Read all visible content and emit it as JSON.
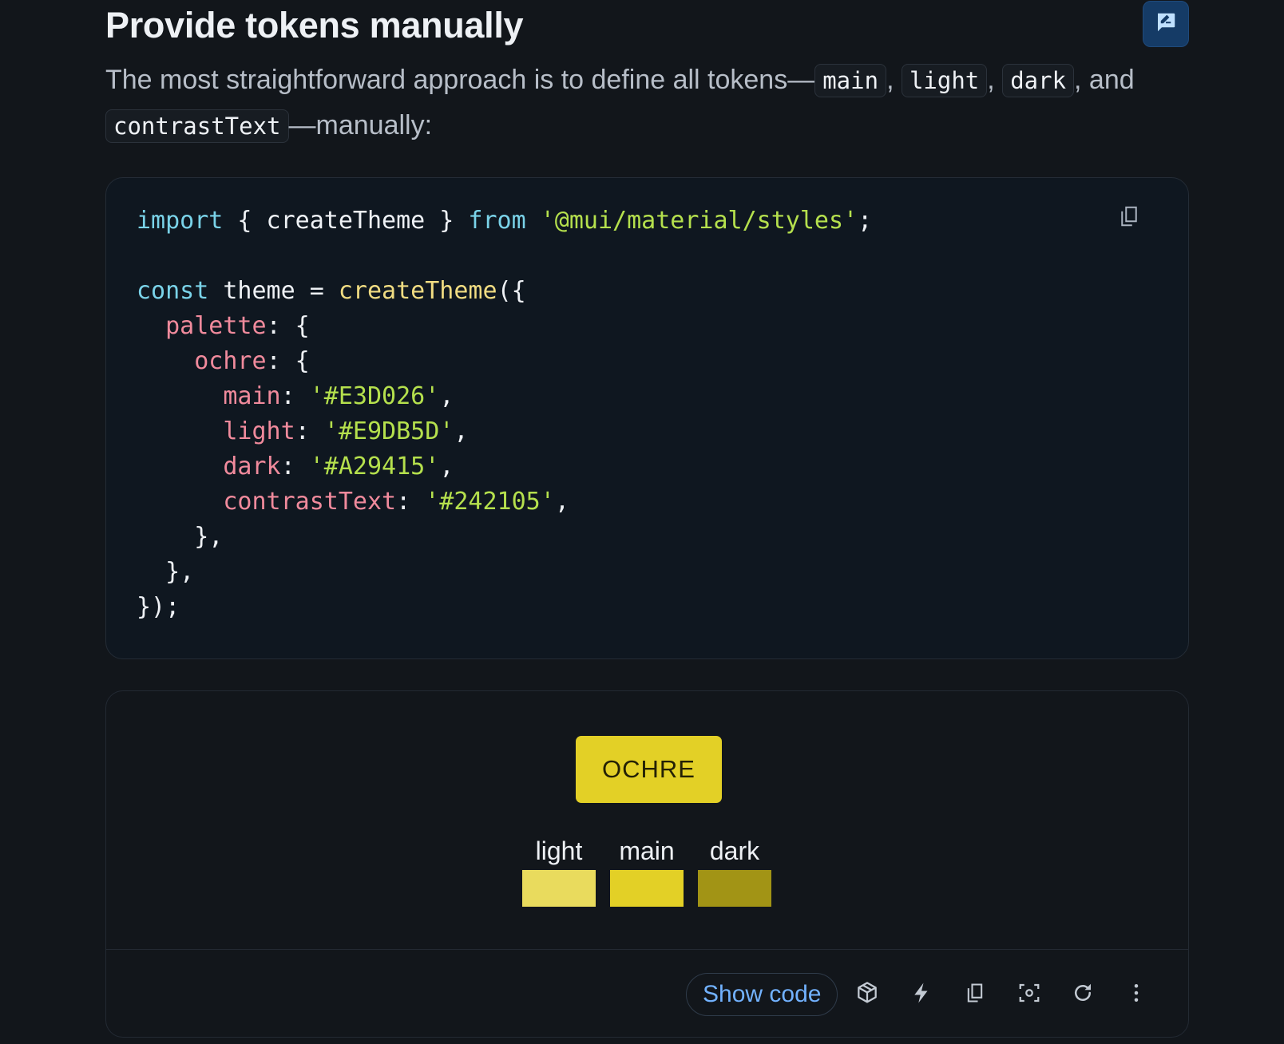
{
  "heading": "Provide tokens manually",
  "intro": {
    "text_1": "The most straightforward approach is to define all tokens—",
    "token_main": "main",
    "sep_1": ", ",
    "token_light": "light",
    "sep_2": ", ",
    "token_dark": "dark",
    "text_2": ", and ",
    "token_contrast": "contrastText",
    "text_3": "—manually:"
  },
  "code": {
    "l1_import": "import",
    "l1_braces": " { createTheme } ",
    "l1_from": "from",
    "l1_space": " ",
    "l1_module": "'@mui/material/styles'",
    "l1_semi": ";",
    "l3_const": "const",
    "l3_theme": " theme = ",
    "l3_fn": "createTheme",
    "l3_open": "({",
    "l4_indent": "  ",
    "l4_prop": "palette",
    "l4_rest": ": {",
    "l5_indent": "    ",
    "l5_prop": "ochre",
    "l5_rest": ": {",
    "l6_indent": "      ",
    "l6_prop": "main",
    "l6_colon": ": ",
    "l6_val": "'#E3D026'",
    "l6_comma": ",",
    "l7_indent": "      ",
    "l7_prop": "light",
    "l7_colon": ": ",
    "l7_val": "'#E9DB5D'",
    "l7_comma": ",",
    "l8_indent": "      ",
    "l8_prop": "dark",
    "l8_colon": ": ",
    "l8_val": "'#A29415'",
    "l8_comma": ",",
    "l9_indent": "      ",
    "l9_prop": "contrastText",
    "l9_colon": ": ",
    "l9_val": "'#242105'",
    "l9_comma": ",",
    "l10": "    },",
    "l11": "  },",
    "l12": "});"
  },
  "demo": {
    "button_label": "OCHRE",
    "swatches": [
      {
        "label": "light",
        "color": "#E9DB5D"
      },
      {
        "label": "main",
        "color": "#E3D026"
      },
      {
        "label": "dark",
        "color": "#A29415"
      }
    ],
    "button_bg": "#E3D026",
    "button_text_color": "#242105"
  },
  "toolbar": {
    "show_code_label": "Show code",
    "icons": [
      "codesandbox-icon",
      "stackblitz-bolt-icon",
      "copy-icon",
      "focus-screenshot-icon",
      "refresh-icon",
      "more-vert-icon"
    ]
  },
  "colors": {
    "background": "#12161b",
    "code_bg": "#0f1720",
    "link": "#72b2ff",
    "feedback_bg": "#153b66"
  }
}
